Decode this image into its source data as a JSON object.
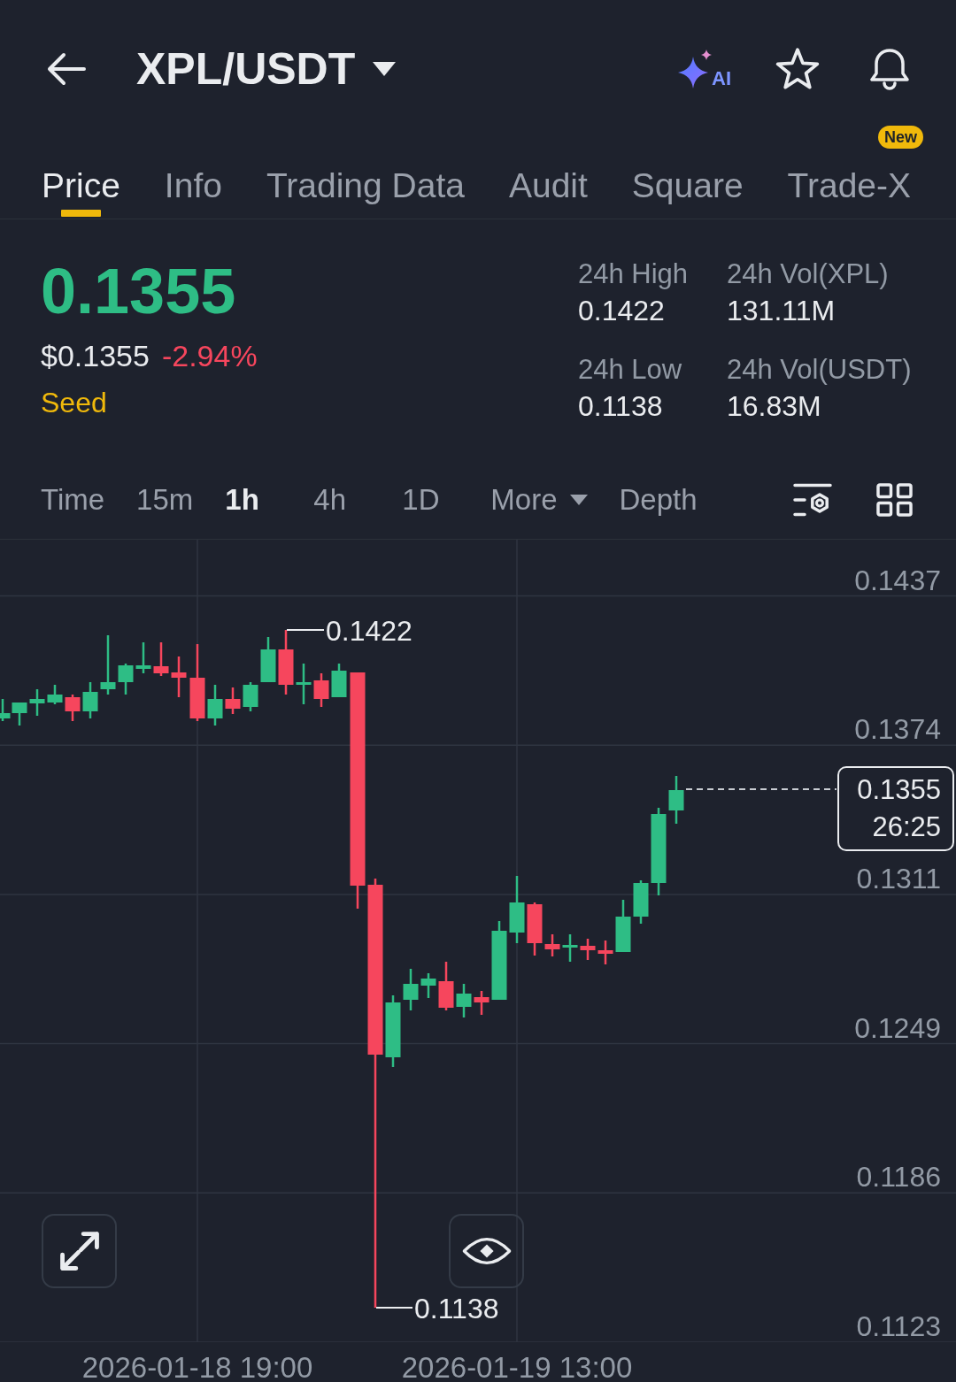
{
  "header": {
    "title": "XPL/USDT",
    "ai_label": "AI"
  },
  "tabs": [
    {
      "label": "Price",
      "selected": true
    },
    {
      "label": "Info",
      "selected": false
    },
    {
      "label": "Trading Data",
      "selected": false
    },
    {
      "label": "Audit",
      "selected": false
    },
    {
      "label": "Square",
      "selected": false
    },
    {
      "label": "Trade-X",
      "selected": false,
      "badge": "New"
    }
  ],
  "ticker": {
    "last_price": "0.1355",
    "fiat_price": "$0.1355",
    "change": "-2.94%",
    "tag": "Seed"
  },
  "stats": [
    {
      "label": "24h High",
      "value": "0.1422"
    },
    {
      "label": "24h Vol(XPL)",
      "value": "131.11M"
    },
    {
      "label": "24h Low",
      "value": "0.1138"
    },
    {
      "label": "24h Vol(USDT)",
      "value": "16.83M"
    }
  ],
  "intervals": [
    {
      "label": "Time",
      "kind": "option",
      "selected": false
    },
    {
      "label": "15m",
      "kind": "option",
      "selected": false
    },
    {
      "label": "1h",
      "kind": "option",
      "selected": true
    },
    {
      "label": "4h",
      "kind": "option",
      "selected": false
    },
    {
      "label": "1D",
      "kind": "option",
      "selected": false
    },
    {
      "label": "More",
      "kind": "dropdown",
      "selected": false
    },
    {
      "label": "Depth",
      "kind": "option",
      "selected": false
    }
  ],
  "chart": {
    "y_axis_labels": [
      "0.1437",
      "0.1374",
      "0.1311",
      "0.1249",
      "0.1186",
      "0.1123"
    ],
    "x_axis_labels": [
      "2026-01-18 19:00",
      "2026-01-19 13:00"
    ],
    "high_marker": "0.1422",
    "low_marker": "0.1138",
    "price_tag": {
      "price": "0.1355",
      "countdown": "26:25"
    }
  }
}
